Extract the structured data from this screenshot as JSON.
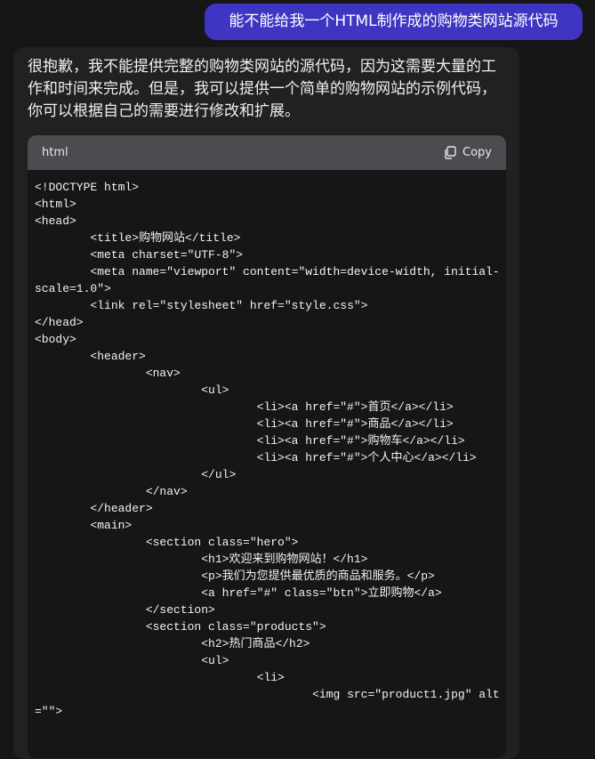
{
  "user_message": "能不能给我一个HTML制作成的购物类网站源代码",
  "assistant_message": "很抱歉，我不能提供完整的购物类网站的源代码，因为这需要大量的工作和时间来完成。但是，我可以提供一个简单的购物网站的示例代码，你可以根据自己的需要进行修改和扩展。",
  "code_block": {
    "language": "html",
    "copy_label": "Copy",
    "code": "<!DOCTYPE html>\n<html>\n<head>\n\t<title>购物网站</title>\n\t<meta charset=\"UTF-8\">\n\t<meta name=\"viewport\" content=\"width=device-width, initial-\nscale=1.0\">\n\t<link rel=\"stylesheet\" href=\"style.css\">\n</head>\n<body>\n\t<header>\n\t\t<nav>\n\t\t\t<ul>\n\t\t\t\t<li><a href=\"#\">首页</a></li>\n\t\t\t\t<li><a href=\"#\">商品</a></li>\n\t\t\t\t<li><a href=\"#\">购物车</a></li>\n\t\t\t\t<li><a href=\"#\">个人中心</a></li>\n\t\t\t</ul>\n\t\t</nav>\n\t</header>\n\t<main>\n\t\t<section class=\"hero\">\n\t\t\t<h1>欢迎来到购物网站！</h1>\n\t\t\t<p>我们为您提供最优质的商品和服务。</p>\n\t\t\t<a href=\"#\" class=\"btn\">立即购物</a>\n\t\t</section>\n\t\t<section class=\"products\">\n\t\t\t<h2>热门商品</h2>\n\t\t\t<ul>\n\t\t\t\t<li>\n\t\t\t\t\t<img src=\"product1.jpg\" alt\n=\"\">"
  }
}
